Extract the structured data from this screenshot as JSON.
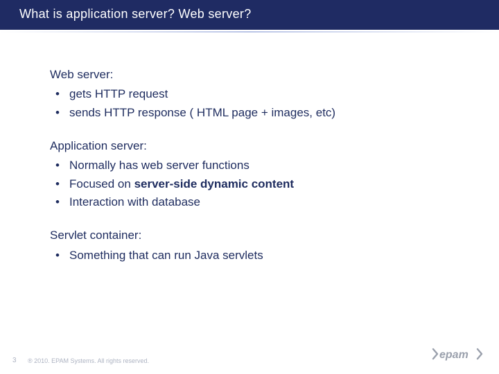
{
  "title": "What is application server? Web server?",
  "sections": [
    {
      "label": "Web server:",
      "items": [
        {
          "text": "gets HTTP request"
        },
        {
          "text": "sends HTTP response ( HTML page + images, etc)"
        }
      ]
    },
    {
      "label": "Application server:",
      "items": [
        {
          "text": "Normally has web server functions"
        },
        {
          "prefix": "Focused on ",
          "strong": "server-side dynamic content"
        },
        {
          "text": "Interaction with database"
        }
      ]
    },
    {
      "label": "Servlet container:",
      "items": [
        {
          "text": "Something that can run Java servlets"
        }
      ]
    }
  ],
  "footer": {
    "page": "3",
    "copyright": "® 2010. EPAM Systems. All rights reserved.",
    "logo_text": "epam"
  }
}
